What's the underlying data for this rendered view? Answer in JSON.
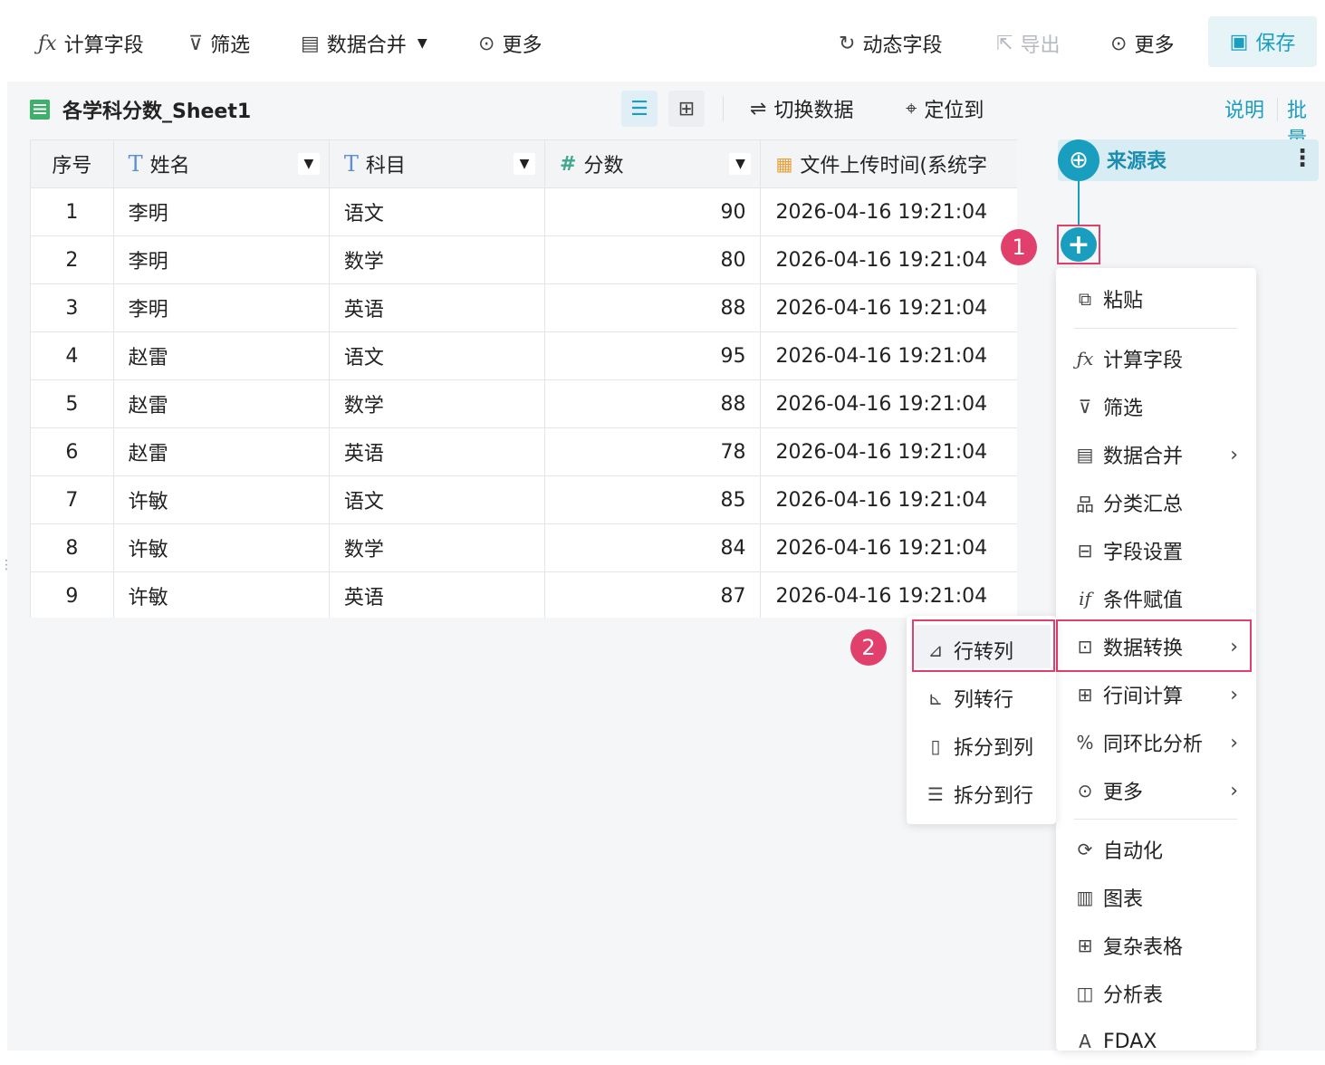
{
  "toolbar": {
    "calc_field": "计算字段",
    "filter": "筛选",
    "merge": "数据合并",
    "more_left": "更多",
    "dynamic_field": "动态字段",
    "export": "导出",
    "more_right": "更多",
    "save": "保存",
    "icons": {
      "calc": "fx-icon",
      "filter": "filter-icon",
      "merge": "merge-icon",
      "more": "more-dots-icon",
      "dynamic": "refresh-icon",
      "export": "export-icon",
      "save": "save-icon"
    }
  },
  "sheet": {
    "title": "各学科分数_Sheet1",
    "switch_data": "切换数据",
    "locate": "定位到"
  },
  "table": {
    "headers": [
      "序号",
      "姓名",
      "科目",
      "分数",
      "文件上传时间(系统字"
    ],
    "header_types": [
      "",
      "T",
      "T",
      "#",
      "date"
    ],
    "rows": [
      [
        "1",
        "李明",
        "语文",
        "90",
        "2026-04-16 19:21:04"
      ],
      [
        "2",
        "李明",
        "数学",
        "80",
        "2026-04-16 19:21:04"
      ],
      [
        "3",
        "李明",
        "英语",
        "88",
        "2026-04-16 19:21:04"
      ],
      [
        "4",
        "赵雷",
        "语文",
        "95",
        "2026-04-16 19:21:04"
      ],
      [
        "5",
        "赵雷",
        "数学",
        "88",
        "2026-04-16 19:21:04"
      ],
      [
        "6",
        "赵雷",
        "英语",
        "78",
        "2026-04-16 19:21:04"
      ],
      [
        "7",
        "许敏",
        "语文",
        "85",
        "2026-04-16 19:21:04"
      ],
      [
        "8",
        "许敏",
        "数学",
        "84",
        "2026-04-16 19:21:04"
      ],
      [
        "9",
        "许敏",
        "英语",
        "87",
        "2026-04-16 19:21:04"
      ]
    ]
  },
  "right_panel": {
    "explain": "说明",
    "batch": "批量",
    "source_node": "来源表",
    "badge1": "1",
    "badge2": "2"
  },
  "menu": {
    "paste": "粘贴",
    "items": [
      {
        "label": "计算字段",
        "icon": "fx-icon"
      },
      {
        "label": "筛选",
        "icon": "filter-icon"
      },
      {
        "label": "数据合并",
        "icon": "merge-icon",
        "submenu": true
      },
      {
        "label": "分类汇总",
        "icon": "hierarchy-icon"
      },
      {
        "label": "字段设置",
        "icon": "field-settings-icon"
      },
      {
        "label": "条件赋值",
        "icon": "if-icon"
      },
      {
        "label": "数据转换",
        "icon": "transform-icon",
        "submenu": true
      },
      {
        "label": "行间计算",
        "icon": "row-calc-icon",
        "submenu": true
      },
      {
        "label": "同环比分析",
        "icon": "percent-icon",
        "submenu": true
      },
      {
        "label": "更多",
        "icon": "more-dots-icon",
        "submenu": true
      }
    ],
    "items2": [
      {
        "label": "自动化",
        "icon": "automation-icon"
      },
      {
        "label": "图表",
        "icon": "chart-icon"
      },
      {
        "label": "复杂表格",
        "icon": "complex-table-icon"
      },
      {
        "label": "分析表",
        "icon": "analysis-icon"
      },
      {
        "label": "FDAX",
        "icon": "fdax-icon"
      }
    ]
  },
  "submenu": {
    "items": [
      {
        "label": "行转列",
        "icon": "row-to-col-icon"
      },
      {
        "label": "列转行",
        "icon": "col-to-row-icon"
      },
      {
        "label": "拆分到列",
        "icon": "split-col-icon"
      },
      {
        "label": "拆分到行",
        "icon": "split-row-icon"
      }
    ]
  },
  "colors": {
    "accent": "#1a9ebf",
    "highlight": "#e2406c"
  }
}
